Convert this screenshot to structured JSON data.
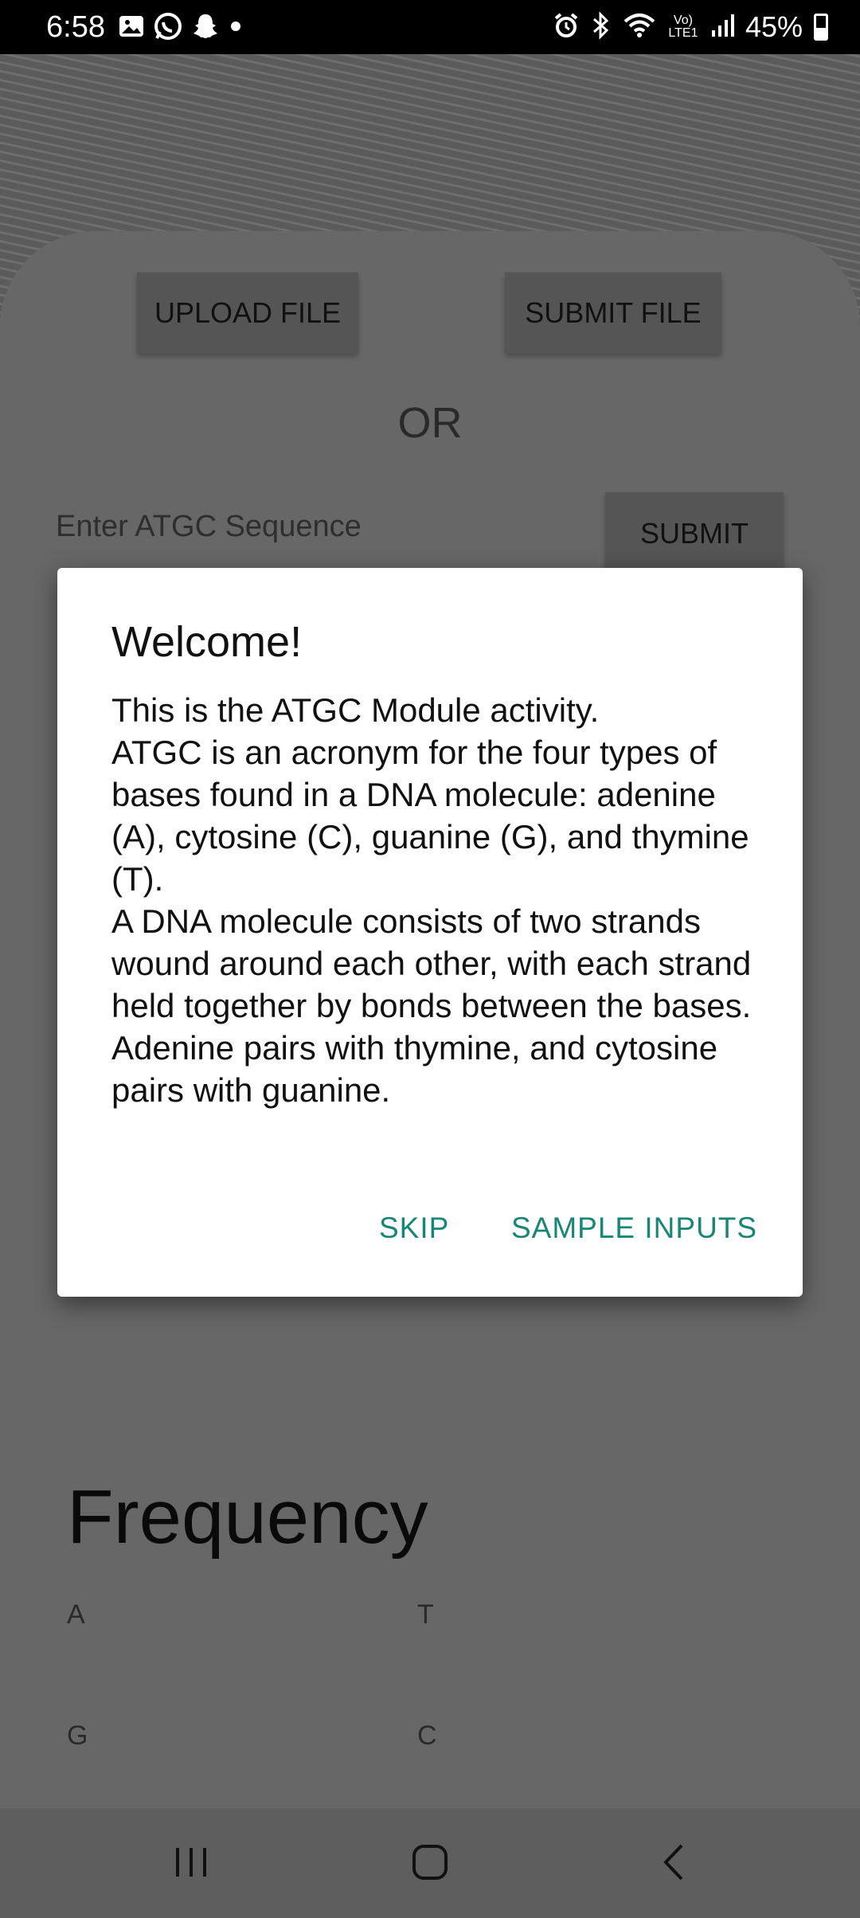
{
  "status_bar": {
    "time": "6:58",
    "battery": "45%",
    "battery_level": 0.45,
    "icons": [
      "gallery-icon",
      "whatsapp-icon",
      "snapchat-icon",
      "dot-icon",
      "alarm-icon",
      "bluetooth-icon",
      "wifi-icon",
      "volte-icon",
      "signal-icon",
      "battery-icon"
    ],
    "volte_label": "Vo) LTE1"
  },
  "main": {
    "upload_label": "UPLOAD FILE",
    "submit_file_label": "SUBMIT FILE",
    "or_label": "OR",
    "sequence_placeholder": "Enter ATGC Sequence",
    "submit_label": "SUBMIT",
    "frequency_title": "Frequency",
    "frequency_labels": {
      "a": "A",
      "t": "T",
      "g": "G",
      "c": "C"
    }
  },
  "dialog": {
    "title": "Welcome!",
    "body": "This is the ATGC Module activity.\nATGC is an acronym for the four types of bases found in a DNA molecule: adenine (A), cytosine (C), guanine (G), and thymine (T).\nA DNA molecule consists of two strands wound around each other, with each strand held together by bonds between the bases.\nAdenine pairs with thymine, and cytosine pairs with guanine.",
    "skip_label": "SKIP",
    "sample_label": "SAMPLE INPUTS",
    "accent_color": "#188676"
  },
  "navbar": {
    "icons": [
      "recents-icon",
      "home-icon",
      "back-icon"
    ]
  }
}
